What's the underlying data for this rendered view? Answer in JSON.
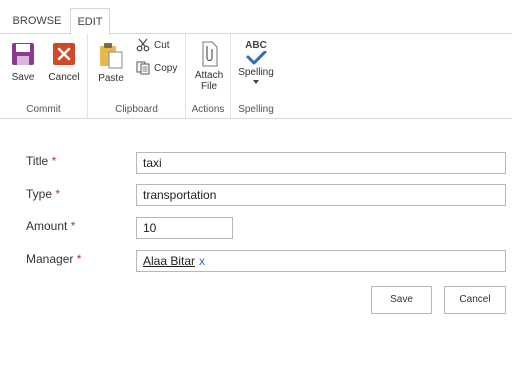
{
  "tabs": {
    "browse": "BROWSE",
    "edit": "EDIT"
  },
  "ribbon": {
    "commit": {
      "group_label": "Commit",
      "save": "Save",
      "cancel": "Cancel"
    },
    "clipboard": {
      "group_label": "Clipboard",
      "paste": "Paste",
      "cut": "Cut",
      "copy": "Copy"
    },
    "actions": {
      "group_label": "Actions",
      "attach_line1": "Attach",
      "attach_line2": "File"
    },
    "spelling": {
      "group_label": "Spelling",
      "spelling": "Spelling",
      "abc": "ABC"
    }
  },
  "form": {
    "title": {
      "label": "Title",
      "required": "*",
      "value": "taxi"
    },
    "type": {
      "label": "Type",
      "required": "*",
      "value": "transportation"
    },
    "amount": {
      "label": "Amount",
      "required": "*",
      "value": "10"
    },
    "manager": {
      "label": "Manager",
      "required": "*",
      "value": "Alaa Bitar",
      "remove": "x"
    }
  },
  "buttons": {
    "save": "Save",
    "cancel": "Cancel"
  },
  "colors": {
    "save_icon": "#8a3b8f",
    "cancel_icon": "#d24726",
    "spelling_check": "#2a6ebb"
  }
}
